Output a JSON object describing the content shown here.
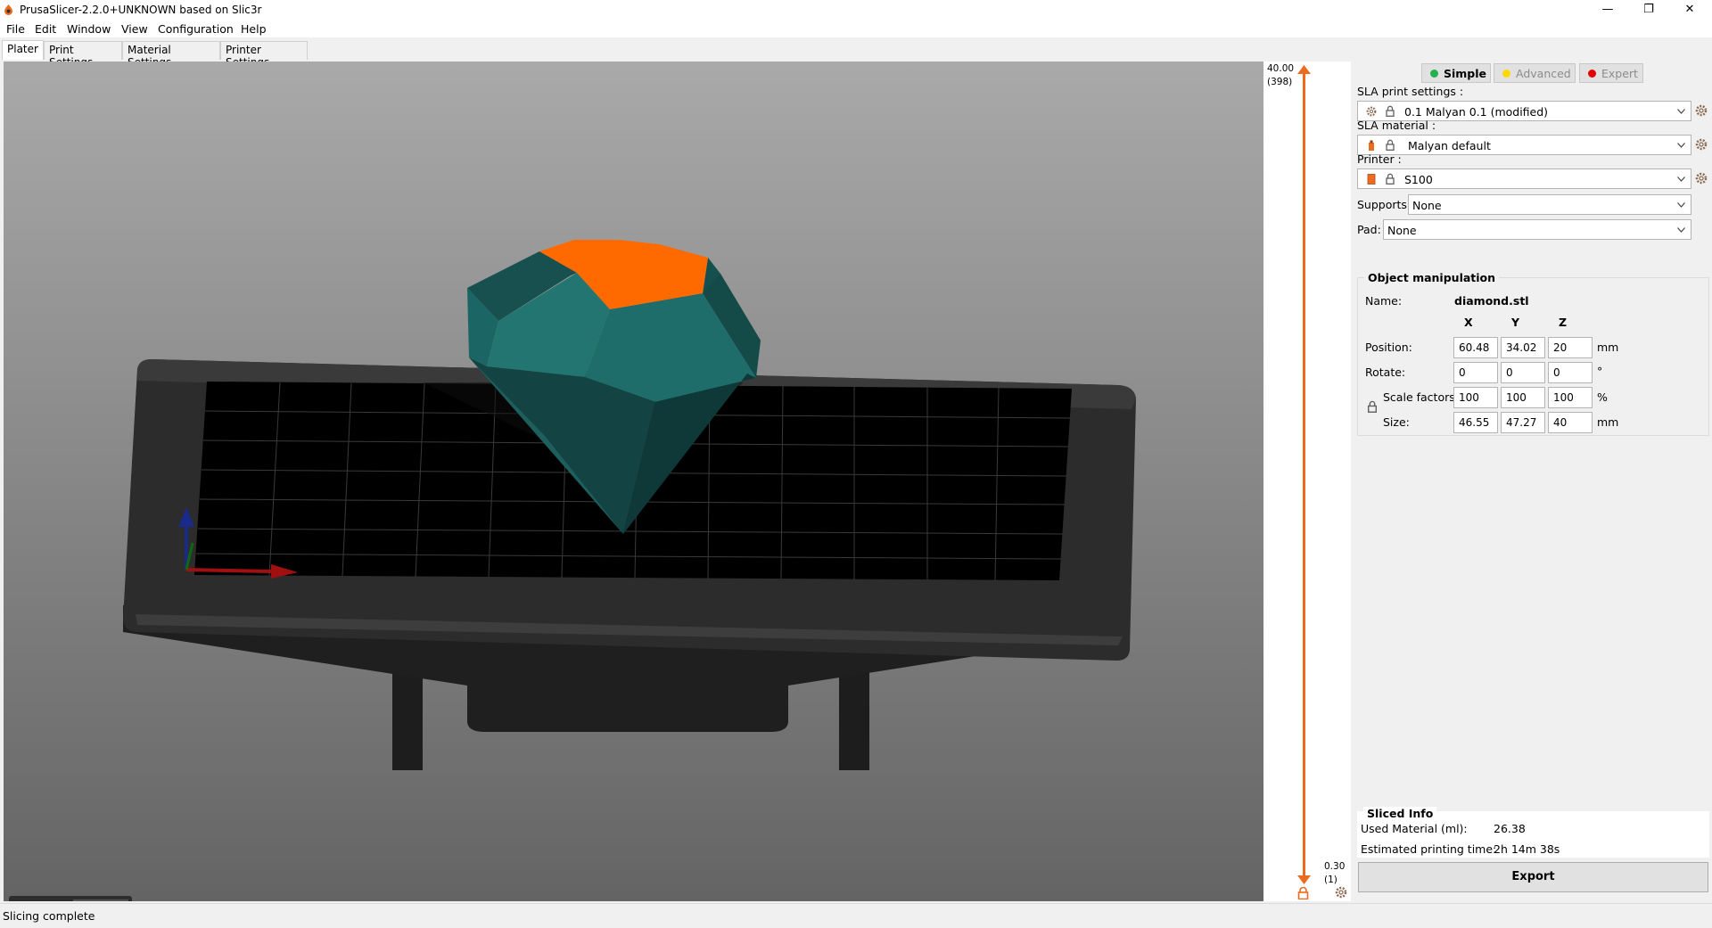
{
  "window": {
    "title": "PrusaSlicer-2.2.0+UNKNOWN based on Slic3r",
    "minimize_glyph": "—",
    "maximize_glyph": "❐",
    "close_glyph": "✕"
  },
  "menu": {
    "items": [
      "File",
      "Edit",
      "Window",
      "View",
      "Configuration",
      "Help"
    ]
  },
  "tabs": [
    {
      "label": "Plater",
      "active": true
    },
    {
      "label": "Print Settings",
      "active": false
    },
    {
      "label": "Material Settings",
      "active": false
    },
    {
      "label": "Printer Settings",
      "active": false
    }
  ],
  "layer_slider": {
    "top_value": "40.00",
    "top_layer": "(398)",
    "bottom_value": "0.30",
    "bottom_layer": "(1)",
    "accent_color": "#ED6B21"
  },
  "mode": {
    "simple": {
      "label": "Simple",
      "color": "#22B14C"
    },
    "advanced": {
      "label": "Advanced",
      "color": "#FFD800"
    },
    "expert": {
      "label": "Expert",
      "color": "#E30000"
    }
  },
  "presets": {
    "print": {
      "label": "SLA print settings :",
      "value": "0.1 Malyan 0.1 (modified)"
    },
    "material": {
      "label": "SLA material :",
      "value": "Malyan default"
    },
    "printer": {
      "label": "Printer :",
      "value": "S100"
    },
    "supports": {
      "label": "Supports:",
      "value": "None"
    },
    "pad": {
      "label": "Pad:",
      "value": "None"
    }
  },
  "object_manipulation": {
    "title": "Object manipulation",
    "name_label": "Name:",
    "name_value": "diamond.stl",
    "axes": [
      "X",
      "Y",
      "Z"
    ],
    "position": {
      "label": "Position:",
      "values": [
        "60.48",
        "34.02",
        "20"
      ],
      "unit": "mm"
    },
    "rotate": {
      "label": "Rotate:",
      "values": [
        "0",
        "0",
        "0"
      ],
      "unit": "°"
    },
    "scale": {
      "label": "Scale factors:",
      "values": [
        "100",
        "100",
        "100"
      ],
      "unit": "%"
    },
    "size": {
      "label": "Size:",
      "values": [
        "46.55",
        "47.27",
        "40"
      ],
      "unit": "mm"
    }
  },
  "sliced_info": {
    "title": "Sliced Info",
    "rows": [
      {
        "label": "Used Material (ml):",
        "value": "26.38"
      },
      {
        "label": "Estimated printing time:",
        "value": "2h 14m 38s"
      }
    ]
  },
  "export_label": "Export",
  "status": "Slicing complete",
  "colors": {
    "model_color": "#1F6E6E",
    "top_face_color": "#FF6A00",
    "bed_color": "#2A2A2A"
  }
}
